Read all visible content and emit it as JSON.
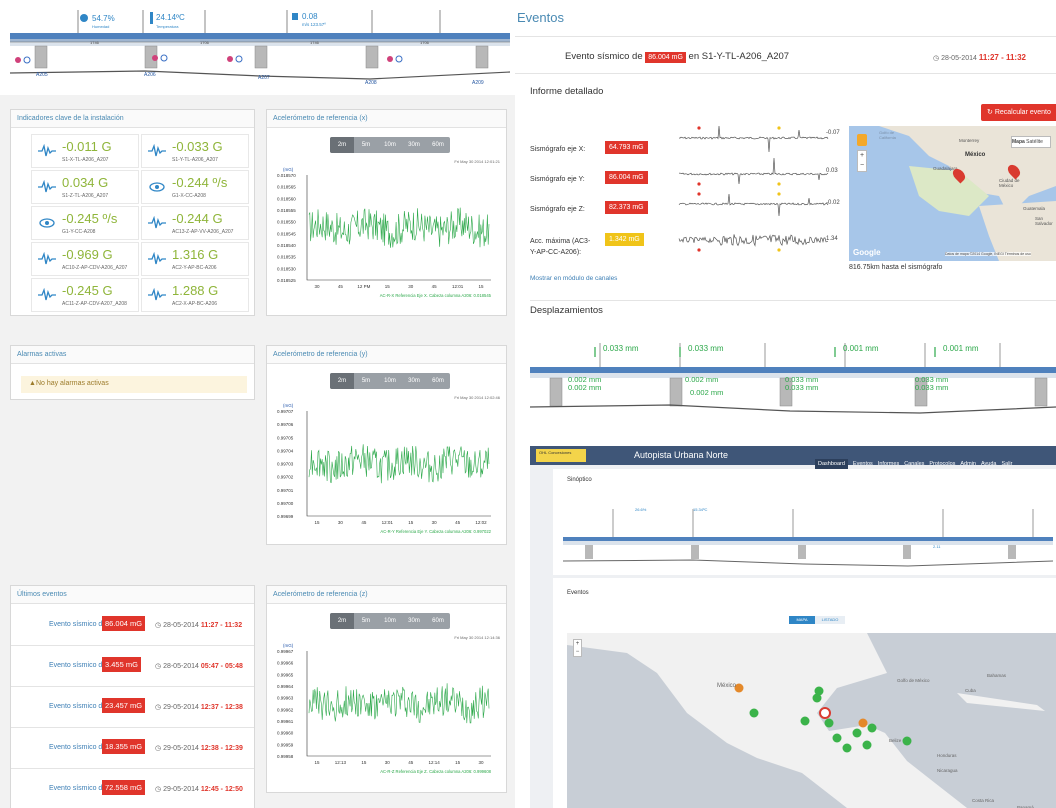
{
  "sinoptico": {
    "sensors": [
      {
        "value": "54.7%",
        "sub": "Humedad"
      },
      {
        "value": "24.14ºC",
        "sub": "Temperatura"
      },
      {
        "value": "0.08",
        "sub": "m/s 123.57º"
      }
    ],
    "columns": [
      "A205",
      "A206",
      "A207",
      "A208",
      "A209"
    ],
    "spans": [
      "1746",
      "1706",
      "1746",
      "1706"
    ]
  },
  "kpi_panel": {
    "title": "Indicadores clave de la instalación",
    "items": [
      {
        "value": "-0.011 G",
        "sub": "S1-X-TL-A206_A207",
        "icon": "wave-icon"
      },
      {
        "value": "-0.033 G",
        "sub": "S1-Y-TL-A206_A207",
        "icon": "wave-icon"
      },
      {
        "value": "0.034 G",
        "sub": "S1-Z-TL-A206_A207",
        "icon": "wave-icon"
      },
      {
        "value": "-0.244 º/s",
        "sub": "G1-X-CC-A208",
        "icon": "gyro-icon"
      },
      {
        "value": "-0.245 º/s",
        "sub": "G1-Y-CC-A208",
        "icon": "gyro-icon"
      },
      {
        "value": "-0.244 G",
        "sub": "AC13-Z-AP-VV-A206_A207",
        "icon": "wave-icon"
      },
      {
        "value": "-0.969 G",
        "sub": "AC10-Z-AP-CDV-A206_A207",
        "icon": "wave-icon"
      },
      {
        "value": "1.316 G",
        "sub": "AC2-Y-AP-BC-A206",
        "icon": "wave-icon"
      },
      {
        "value": "-0.245 G",
        "sub": "AC11-Z-AP-CDV-A207_A208",
        "icon": "wave-icon"
      },
      {
        "value": "1.288 G",
        "sub": "AC2-X-AP-BC-A206",
        "icon": "wave-icon"
      }
    ]
  },
  "alarms": {
    "title": "Alarmas activas",
    "empty": "No hay alarmas activas"
  },
  "events_panel": {
    "title": "Últimos eventos",
    "prefix": "Evento sísmico de",
    "items": [
      {
        "value": "86.004 mG",
        "date": "28-05-2014",
        "range": "11:27 - 11:32"
      },
      {
        "value": "3.455 mG",
        "date": "28-05-2014",
        "range": "05:47 - 05:48"
      },
      {
        "value": "23.457 mG",
        "date": "29-05-2014",
        "range": "12:37 - 12:38"
      },
      {
        "value": "18.355 mG",
        "date": "29-05-2014",
        "range": "12:38 - 12:39"
      },
      {
        "value": "72.558 mG",
        "date": "29-05-2014",
        "range": "12:45 - 12:50"
      }
    ]
  },
  "accel": {
    "ranges": [
      "2m",
      "5m",
      "10m",
      "30m",
      "60m"
    ],
    "unit": "(mG)",
    "charts": [
      {
        "title": "Acelerómetro de referencia (x)",
        "date": "Fri May 30 2014 12:01:21",
        "ticks": [
          "0.018570",
          "0.018565",
          "0.018560",
          "0.018555",
          "0.018550",
          "0.018545",
          "0.018540",
          "0.018535",
          "0.018530",
          "0.018525"
        ],
        "xticks": [
          "30",
          "45",
          "12 PM",
          "15",
          "30",
          "45",
          "12:01",
          "15"
        ],
        "legend": "AC-R-X Referencia Eje X. Cabeza columna A206: 0.018545",
        "color": "#2ca84a"
      },
      {
        "title": "Acelerómetro de referencia (y)",
        "date": "Fri May 30 2014 12:02:46",
        "ticks": [
          "0.99707",
          "0.99706",
          "0.99705",
          "0.99704",
          "0.99703",
          "0.99702",
          "0.99701",
          "0.99700",
          "0.99699"
        ],
        "xticks": [
          "15",
          "30",
          "45",
          "12:01",
          "15",
          "30",
          "45",
          "12:02"
        ],
        "legend": "AC-R-Y Referencia Eje Y. Cabeza columna A206: 0.997022",
        "color": "#2ca84a"
      },
      {
        "title": "Acelerómetro de referencia (z)",
        "date": "Fri May 30 2014 12:14:36",
        "ticks": [
          "0.99967",
          "0.99966",
          "0.99965",
          "0.99964",
          "0.99963",
          "0.99962",
          "0.99961",
          "0.99960",
          "0.99959",
          "0.99958"
        ],
        "xticks": [
          "15",
          "12:13",
          "15",
          "30",
          "45",
          "12:14",
          "15",
          "30"
        ],
        "legend": "AC-R-Z Referencia Eje Z. Cabeza columna A206: 0.999608",
        "color": "#2ca84a"
      }
    ]
  },
  "eventos_page": {
    "heading": "Eventos",
    "event_prefix": "Evento sísmico de",
    "event_value": "86.004 mG",
    "event_suffix": "en S1-Y-TL-A206_A207",
    "event_date": "28-05-2014",
    "event_range": "11:27 - 11:32",
    "informe_title": "Informe detallado",
    "recalc": "Recalcular evento",
    "rows": [
      {
        "label": "Sismógrafo eje X:",
        "value": "64.793 mG",
        "color": "#e0352b"
      },
      {
        "label": "Sismógrafo eje Y:",
        "value": "86.004 mG",
        "color": "#e0352b"
      },
      {
        "label": "Sismógrafo eje Z:",
        "value": "82.373 mG",
        "color": "#e0352b"
      },
      {
        "label": "Acc. máxima (AC3-Y-AP-CC-A206):",
        "value": "1.342 mG",
        "color": "#f0c419"
      }
    ],
    "trace_values": [
      "-0.07",
      "0.03",
      "-0.02",
      "1.34"
    ],
    "mostrar": "Mostrar en módulo de canales",
    "map_distance": "816.75km hasta el sismógrafo",
    "map_tabs": [
      "Mapa",
      "Satélite"
    ],
    "map_labels": [
      "Monterrey",
      "México",
      "Guadalajara",
      "Ciudad de México",
      "Guatemala",
      "San Salvador",
      "Golfo de California"
    ],
    "map_footer": "Datos de mapa ©2014 Google, INEGI  Términos de uso",
    "desp_title": "Desplazamientos",
    "desp_top": [
      "0.033 mm",
      "0.033 mm",
      "0.001 mm",
      "0.001 mm"
    ],
    "desp_bottom": [
      "0.002 mm",
      "0.002 mm",
      "0.002 mm",
      "0.002 mm",
      "0.033 mm",
      "0.033 mm",
      "0.033 mm",
      "0.033 mm"
    ]
  },
  "app": {
    "brand": "OHL Concesiones",
    "title": "Autopista Urbana Norte",
    "nav": [
      "Dashboard",
      "Eventos",
      "Informes",
      "Canales",
      "Protocolos",
      "Admin",
      "Ayuda",
      "Salir"
    ],
    "sinoptico_title": "Sinóptico",
    "sinoptico_values": [
      "26.6%",
      "15.34ºC",
      "2.11"
    ],
    "eventos_title": "Eventos",
    "tabs": [
      "MAPA",
      "LISTADO"
    ],
    "map_labels": [
      "México",
      "Golfo de México",
      "Cuba",
      "Bahamas",
      "Honduras",
      "Nicaragua",
      "Costa Rica",
      "Panamá",
      "Belize"
    ]
  }
}
